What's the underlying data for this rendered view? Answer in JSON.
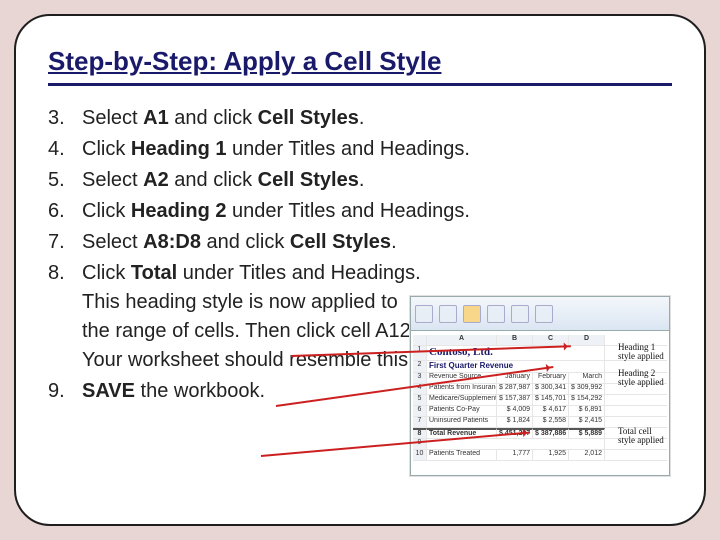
{
  "title": "Step-by-Step: Apply a Cell Style",
  "steps": [
    {
      "n": "3.",
      "html": "Select <span class='b'>A1</span> and click <span class='b'>Cell Styles</span>."
    },
    {
      "n": "4.",
      "html": "Click <span class='b'>Heading 1</span> under Titles and Headings."
    },
    {
      "n": "5.",
      "html": "Select <span class='b'>A2</span> and click <span class='b'>Cell Styles</span>."
    },
    {
      "n": "6.",
      "html": "Click <span class='b'>Heading 2</span> under Titles and Headings."
    },
    {
      "n": "7.",
      "html": "Select <span class='b'>A8:D8</span> and click <span class='b'>Cell Styles</span>."
    },
    {
      "n": "8.",
      "html": "Click <span class='b'>Total</span> under Titles and Headings. This heading style is now applied to the range of cells. Then click cell A12. Your worksheet should resemble this."
    },
    {
      "n": "9.",
      "html": "<span class='b'>SAVE</span> the workbook."
    }
  ],
  "excel": {
    "contoso": "Contoso, Ltd.",
    "subtitle": "First Quarter Revenue",
    "cols": [
      "",
      "A",
      "B",
      "C",
      "D"
    ],
    "months": [
      "January",
      "February",
      "March"
    ],
    "rows": [
      {
        "r": "3",
        "label": "Revenue Source"
      },
      {
        "r": "4",
        "label": "Patients from Insurance",
        "v": [
          "$ 287,987",
          "$ 300,341",
          "$ 309,992"
        ]
      },
      {
        "r": "5",
        "label": "Medicare/Supplement",
        "v": [
          "$ 157,387",
          "$ 145,701",
          "$ 154,292"
        ]
      },
      {
        "r": "6",
        "label": "Patients Co-Pay",
        "v": [
          "$ 4,009",
          "$ 4,617",
          "$ 6,891"
        ]
      },
      {
        "r": "7",
        "label": "Uninsured Patients",
        "v": [
          "$ 1,824",
          "$ 2,558",
          "$ 2,415"
        ]
      }
    ],
    "total": {
      "r": "8",
      "label": "Total Revenue",
      "v": [
        "$ 451,207",
        "$ 387,886",
        "$ 5,889"
      ]
    },
    "footer": {
      "r": "10",
      "label": "Patients Treated",
      "v": [
        "1,777",
        "1,925",
        "2,012"
      ]
    },
    "annotations": {
      "h1": "Heading 1 style applied",
      "h2": "Heading 2 style applied",
      "tot": "Total cell style applied"
    }
  }
}
